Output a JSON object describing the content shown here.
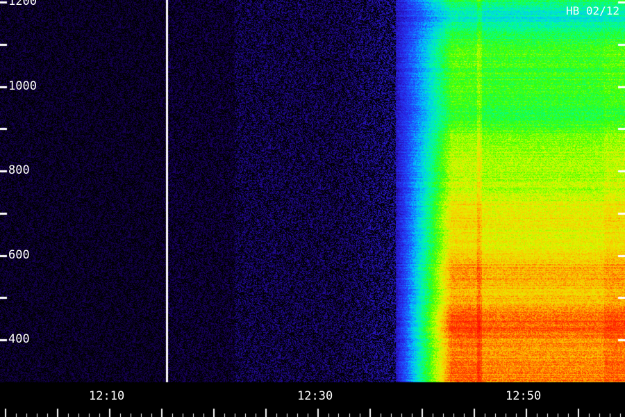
{
  "chart_data": {
    "type": "heatmap",
    "title": "",
    "annotation": "HB 02/12",
    "xlabel": "",
    "ylabel": "",
    "x_ticks": [
      "12:10",
      "12:30",
      "12:50"
    ],
    "x_tick_minutes": [
      10,
      30,
      50
    ],
    "x_range_minutes": [
      -0.5,
      59.5
    ],
    "panel_break_minutes": [
      15.5,
      57.5
    ],
    "y_ticks": [
      400,
      600,
      800,
      1000,
      1200
    ],
    "ylim": [
      300,
      1205
    ],
    "background_color": "#000000",
    "colormap": [
      "#000000",
      "#1a0066",
      "#2a1ad8",
      "#1f4cff",
      "#00c8ff",
      "#00ff9c",
      "#33ff00",
      "#d8ff00",
      "#ffc400",
      "#ff3a00",
      "#ff0000"
    ],
    "emission_onset_minutes": 41.5,
    "bright_event_minutes": 45.5,
    "bright_events_minutes": [
      45.5,
      57.5
    ]
  }
}
